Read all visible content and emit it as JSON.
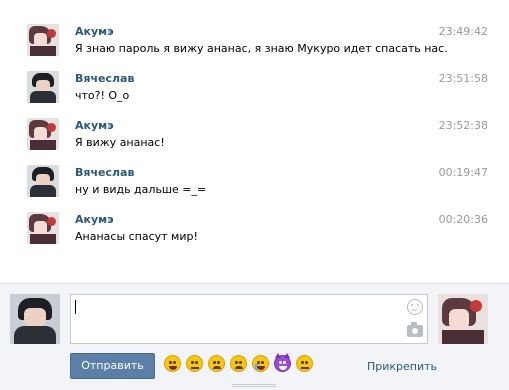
{
  "messages": [
    {
      "author": "Акумэ",
      "text": "Я знаю пароль я вижу ананас, я знаю Мукуро идет спасать нас.",
      "time": "23:49:42",
      "avatar": "akume"
    },
    {
      "author": "Вячеслав",
      "text": "что?! О_о",
      "time": "23:51:58",
      "avatar": "vyacheslav"
    },
    {
      "author": "Акумэ",
      "text": "Я вижу ананас!",
      "time": "23:52:38",
      "avatar": "akume"
    },
    {
      "author": "Вячеслав",
      "text": "ну и видь дальше =_=",
      "time": "00:19:47",
      "avatar": "vyacheslav"
    },
    {
      "author": "Акумэ",
      "text": "Ананасы спасут мир!",
      "time": "00:20:36",
      "avatar": "akume"
    }
  ],
  "composer": {
    "value": "",
    "send_label": "Отправить",
    "attach_label": "Прикрепить",
    "emoji_icons": [
      "grin",
      "blush",
      "sad",
      "tired",
      "cry",
      "devil",
      "neutral"
    ]
  },
  "colors": {
    "author_link": "#2b587a",
    "send_button": "#5b7fa6",
    "footer_bg": "#f2f4f7",
    "timestamp": "#999999"
  }
}
